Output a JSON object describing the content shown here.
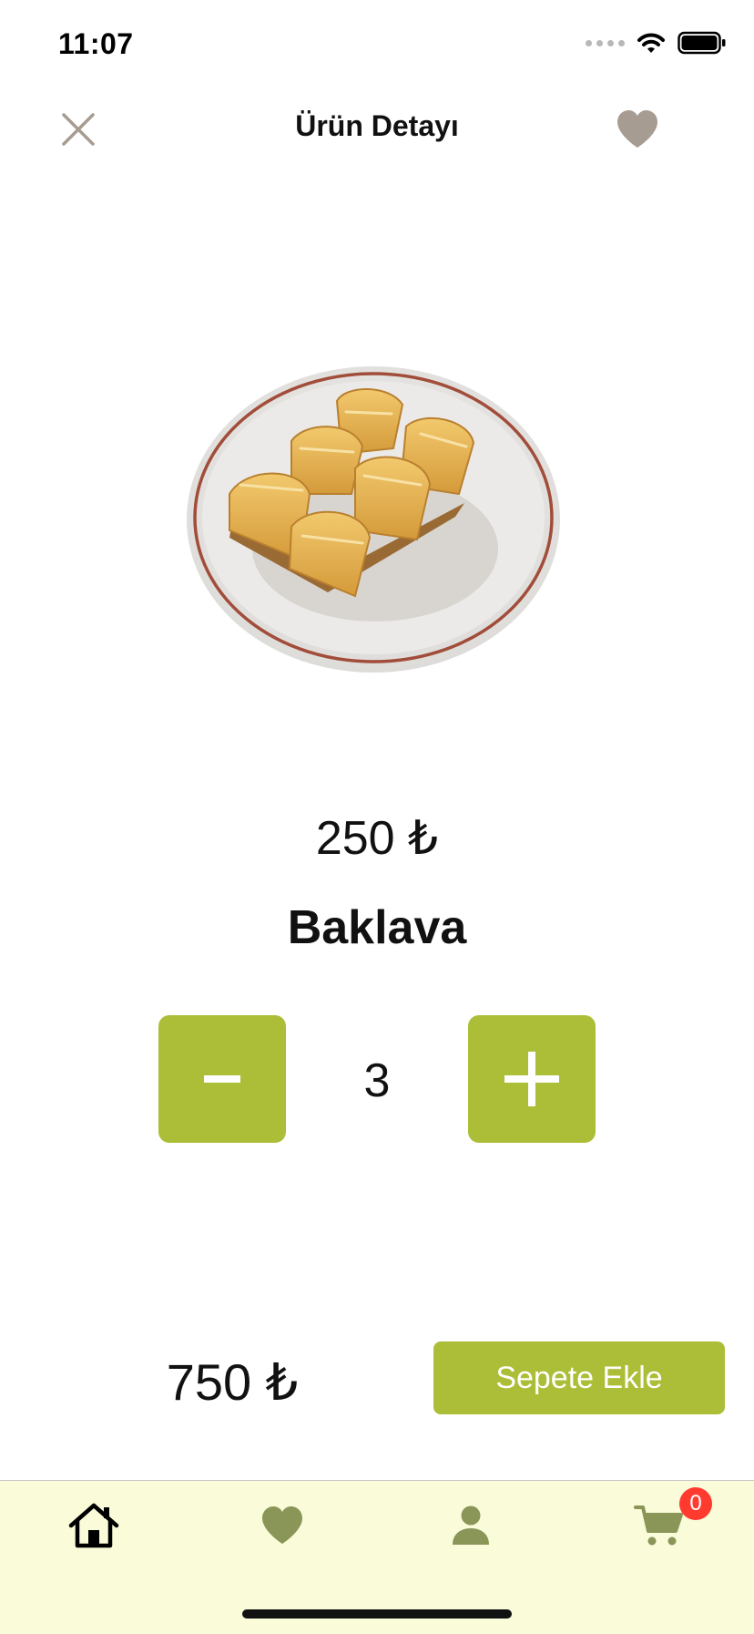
{
  "status_bar": {
    "time": "11:07"
  },
  "nav": {
    "title": "Ürün Detayı"
  },
  "product": {
    "price": "250 ₺",
    "name": "Baklava"
  },
  "stepper": {
    "quantity": "3"
  },
  "footer": {
    "total": "750 ₺",
    "add_to_cart_label": "Sepete Ekle"
  },
  "tab_bar": {
    "tabs": [
      {
        "icon": "home-icon"
      },
      {
        "icon": "heart-icon"
      },
      {
        "icon": "person-icon"
      },
      {
        "icon": "cart-icon"
      }
    ],
    "cart_badge": "0"
  },
  "colors": {
    "accent": "#acbe37",
    "icon_muted": "#a79c91",
    "tab_icon": "#8a9558",
    "tab_bar_bg": "#fafbd9",
    "badge": "#ff3b30"
  }
}
